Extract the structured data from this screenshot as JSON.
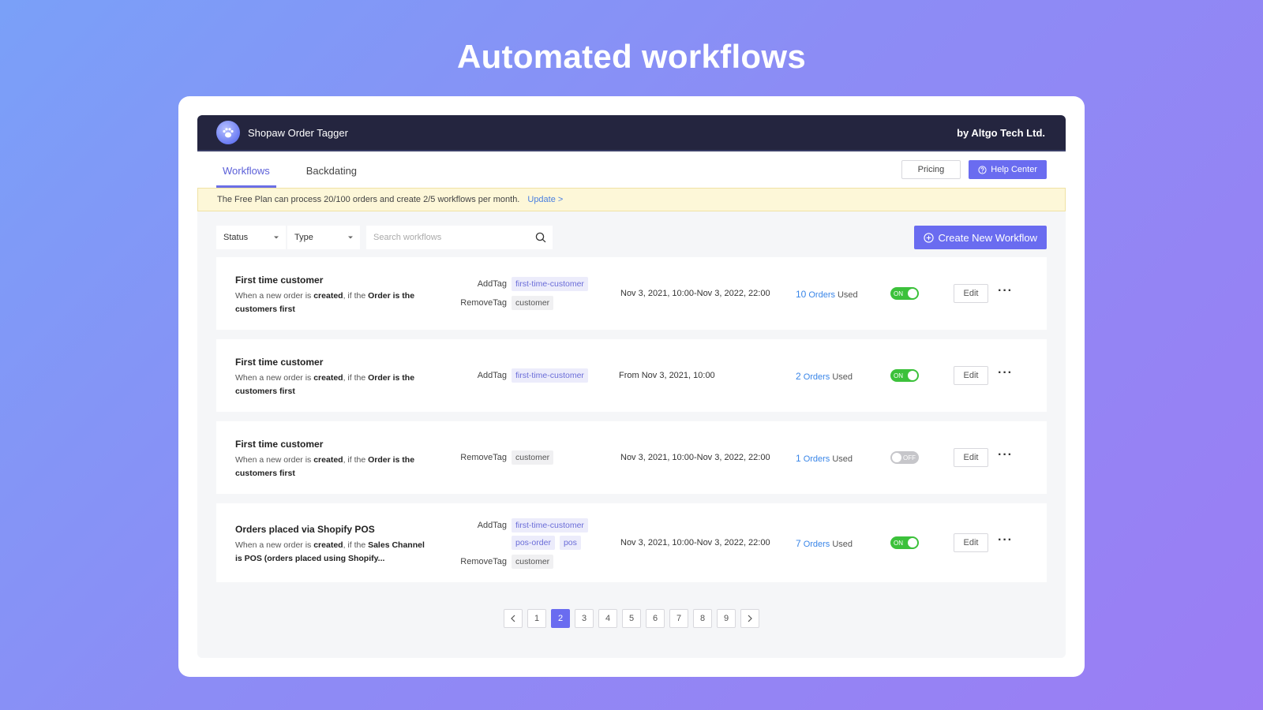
{
  "hero": {
    "title": "Automated workflows"
  },
  "app": {
    "name": "Shopaw Order Tagger",
    "vendor": "by Altgo Tech Ltd."
  },
  "nav": {
    "tabs": [
      {
        "label": "Workflows",
        "active": true
      },
      {
        "label": "Backdating",
        "active": false
      }
    ],
    "pricing_label": "Pricing",
    "help_label": "Help Center"
  },
  "notice": {
    "text": "The Free Plan can process 20/100 orders and create 2/5 workflows per month.",
    "link": "Update >"
  },
  "filters": {
    "status_label": "Status",
    "type_label": "Type",
    "search_placeholder": "Search workflows",
    "create_label": "Create New Workflow"
  },
  "workflows": [
    {
      "title": "First time customer",
      "desc": {
        "p1": "When a new order is ",
        "b1": "created",
        "p2": ", if the ",
        "b2": "Order is the customers first"
      },
      "add_label": "AddTag",
      "add_tags": [
        "first-time-customer"
      ],
      "remove_label": "RemoveTag",
      "remove_tags": [
        "customer"
      ],
      "date": "Nov 3, 2021, 10:00-Nov 3, 2022, 22:00",
      "orders": "10",
      "orders_word": "Orders",
      "used_word": "Used",
      "status": "ON",
      "edit_label": "Edit"
    },
    {
      "title": "First time customer",
      "desc": {
        "p1": "When a new order is ",
        "b1": "created",
        "p2": ", if the ",
        "b2": "Order is the customers first"
      },
      "add_label": "AddTag",
      "add_tags": [
        "first-time-customer"
      ],
      "date": "From Nov 3, 2021, 10:00",
      "orders": "2",
      "orders_word": "Orders",
      "used_word": "Used",
      "status": "ON",
      "edit_label": "Edit"
    },
    {
      "title": "First time customer",
      "desc": {
        "p1": "When a new order is ",
        "b1": "created",
        "p2": ", if the ",
        "b2": "Order is the customers first"
      },
      "remove_label": "RemoveTag",
      "remove_tags": [
        "customer"
      ],
      "date": "Nov 3, 2021, 10:00-Nov 3, 2022, 22:00",
      "orders": "1",
      "orders_word": "Orders",
      "used_word": "Used",
      "status": "OFF",
      "edit_label": "Edit"
    },
    {
      "title": "Orders placed via Shopify POS",
      "desc": {
        "p1": "When a new order is ",
        "b1": "created",
        "p2": ", if the ",
        "b2": "Sales Channel is POS (orders placed using Shopify..."
      },
      "add_label": "AddTag",
      "add_tags": [
        "first-time-customer",
        "pos-order",
        "pos"
      ],
      "remove_label": "RemoveTag",
      "remove_tags": [
        "customer"
      ],
      "date": "Nov 3, 2021, 10:00-Nov 3, 2022, 22:00",
      "orders": "7",
      "orders_word": "Orders",
      "used_word": "Used",
      "status": "ON",
      "edit_label": "Edit"
    }
  ],
  "pagination": {
    "pages": [
      "1",
      "2",
      "3",
      "4",
      "5",
      "6",
      "7",
      "8",
      "9"
    ],
    "current": "2"
  },
  "colors": {
    "accent": "#6a6cf0",
    "topbar": "#24253f",
    "toggle_on": "#3cc13b",
    "link": "#3a86e8"
  }
}
